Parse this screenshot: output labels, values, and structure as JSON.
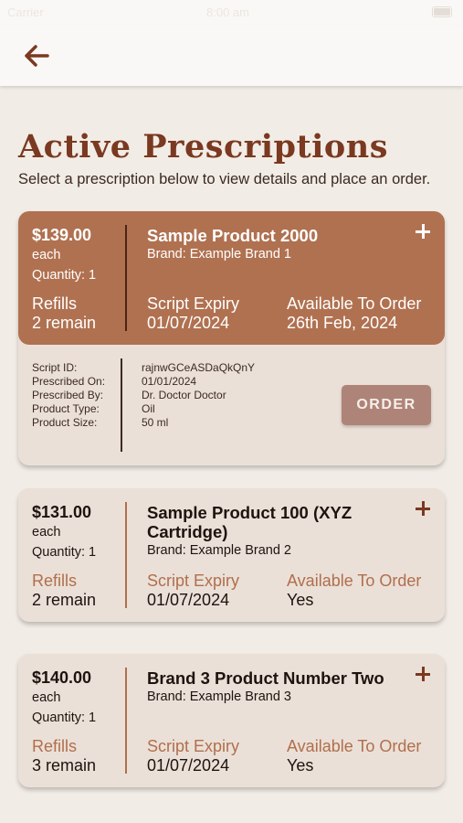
{
  "status_bar": {
    "carrier": "Carrier",
    "time": "8:00 am"
  },
  "header": {
    "back_icon": "arrow-left-icon",
    "accent": "#7a3920"
  },
  "page": {
    "title": "Active Prescriptions",
    "subtitle": "Select a prescription below to view details and place an order."
  },
  "labels": {
    "refills": "Refills",
    "script_expiry": "Script Expiry",
    "available": "Available To Order",
    "order_button": "ORDER"
  },
  "detail_labels": [
    "Script ID:",
    "Prescribed On:",
    "Prescribed By:",
    "Product Type:",
    "Product Size:"
  ],
  "prescriptions": [
    {
      "price": "$139.00",
      "unit": "each",
      "quantity": "Quantity: 1",
      "name": "Sample Product 2000",
      "brand": "Brand: Example Brand 1",
      "refills": "2 remain",
      "expiry": "01/07/2024",
      "available": "26th Feb, 2024",
      "expanded": true,
      "details": {
        "script_id": "rajnwGCeASDaQkQnY",
        "prescribed_on": "01/01/2024",
        "prescribed_by": "Dr. Doctor Doctor",
        "product_type": "Oil",
        "product_size": "50 ml"
      }
    },
    {
      "price": "$131.00",
      "unit": "each",
      "quantity": "Quantity: 1",
      "name": "Sample Product 100 (XYZ Cartridge)",
      "brand": "Brand: Example Brand 2",
      "refills": "2 remain",
      "expiry": "01/07/2024",
      "available": "Yes",
      "expanded": false
    },
    {
      "price": "$140.00",
      "unit": "each",
      "quantity": "Quantity: 1",
      "name": "Brand 3 Product Number Two",
      "brand": "Brand: Example Brand 3",
      "refills": "3 remain",
      "expiry": "01/07/2024",
      "available": "Yes",
      "expanded": false
    }
  ],
  "colors": {
    "accent": "#b07150",
    "title": "#7a3920",
    "card": "#ebe0d7",
    "background": "#f2ece6"
  }
}
